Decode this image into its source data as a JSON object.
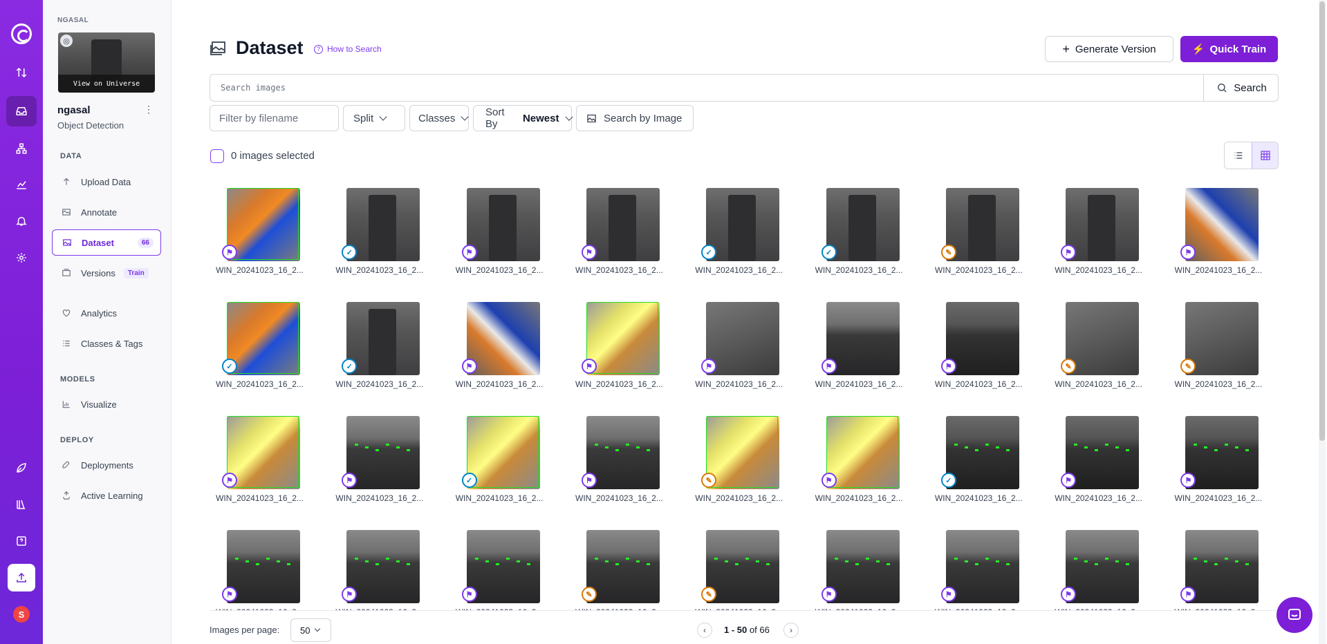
{
  "workspace": {
    "label": "NGASAL",
    "thumb_label": "View on Universe"
  },
  "project": {
    "name": "ngasal",
    "type": "Object Detection"
  },
  "sidebar": {
    "sections": {
      "data": "DATA",
      "models": "MODELS",
      "deploy": "DEPLOY"
    },
    "items": [
      {
        "label": "Upload Data",
        "icon": "upload-icon"
      },
      {
        "label": "Annotate",
        "icon": "annotate-icon"
      },
      {
        "label": "Dataset",
        "icon": "dataset-icon",
        "badge": "66",
        "active": true
      },
      {
        "label": "Versions",
        "icon": "versions-icon",
        "badge": "Train"
      },
      {
        "label": "Analytics",
        "icon": "analytics-icon"
      },
      {
        "label": "Classes & Tags",
        "icon": "classes-icon"
      },
      {
        "label": "Visualize",
        "icon": "visualize-icon"
      },
      {
        "label": "Deployments",
        "icon": "deployments-icon"
      },
      {
        "label": "Active Learning",
        "icon": "active-learning-icon"
      }
    ]
  },
  "rail": {
    "avatar": "S"
  },
  "header": {
    "title": "Dataset",
    "how_to": "How to Search",
    "generate": "Generate Version",
    "quick_train": "Quick Train"
  },
  "search": {
    "placeholder": "Search images",
    "button": "Search"
  },
  "filters": {
    "filename_placeholder": "Filter by filename",
    "split": "Split",
    "classes": "Classes",
    "sort_label": "Sort By",
    "sort_value": "Newest",
    "by_image": "Search by Image"
  },
  "selection": {
    "text": "0 images selected"
  },
  "grid": {
    "filename": "WIN_20241023_16_2...",
    "rows": [
      [
        "train",
        "valid",
        "train",
        "train",
        "valid",
        "valid",
        "test",
        "train",
        "train"
      ],
      [
        "valid",
        "valid",
        "train",
        "train",
        "train",
        "train",
        "train",
        "test",
        "test"
      ],
      [
        "train",
        "train",
        "valid",
        "train",
        "test",
        "train",
        "valid",
        "train",
        "train"
      ],
      [
        "train",
        "train",
        "train",
        "test",
        "test",
        "train",
        "train",
        "train",
        "train"
      ]
    ]
  },
  "footer": {
    "per_page_label": "Images per page:",
    "per_page": "50",
    "range": "1 - 50",
    "of": "of",
    "total": "66"
  }
}
